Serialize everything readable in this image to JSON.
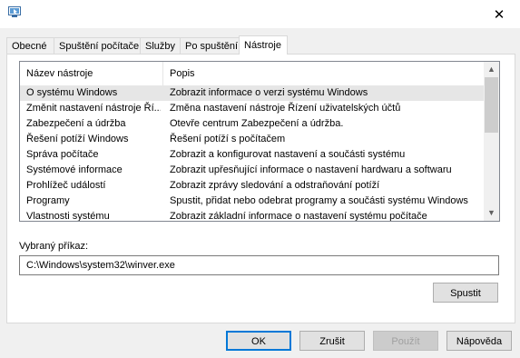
{
  "window": {
    "icon": "msconfig-icon",
    "close_glyph": "✕"
  },
  "tabs": [
    {
      "label": "Obecné"
    },
    {
      "label": "Spuštění počítače"
    },
    {
      "label": "Služby"
    },
    {
      "label": "Po spuštění"
    },
    {
      "label": "Nástroje",
      "active": true
    }
  ],
  "tools_list": {
    "columns": [
      "Název nástroje",
      "Popis"
    ],
    "rows": [
      {
        "name": "O systému Windows",
        "desc": "Zobrazit informace o verzi systému Windows",
        "selected": true
      },
      {
        "name": "Změnit nastavení nástroje Ří...",
        "desc": "Změna nastavení nástroje Řízení uživatelských účtů"
      },
      {
        "name": "Zabezpečení a údržba",
        "desc": "Otevře centrum Zabezpečení a údržba."
      },
      {
        "name": "Řešení potíží Windows",
        "desc": "Řešení potíží s počítačem"
      },
      {
        "name": "Správa počítače",
        "desc": "Zobrazit a konfigurovat nastavení a součásti systému"
      },
      {
        "name": "Systémové informace",
        "desc": "Zobrazit upřesňující informace o nastavení hardwaru a softwaru"
      },
      {
        "name": "Prohlížeč událostí",
        "desc": "Zobrazit zprávy sledování a odstraňování potíží"
      },
      {
        "name": "Programy",
        "desc": "Spustit, přidat nebo odebrat programy a součásti systému Windows"
      },
      {
        "name": "Vlastnosti systému",
        "desc": "Zobrazit základní informace o nastavení systému počítače"
      }
    ]
  },
  "command": {
    "label": "Vybraný příkaz:",
    "value": "C:\\Windows\\system32\\winver.exe"
  },
  "run_button": "Spustit",
  "footer": {
    "ok": "OK",
    "cancel": "Zrušit",
    "apply": "Použít",
    "help": "Nápověda"
  }
}
